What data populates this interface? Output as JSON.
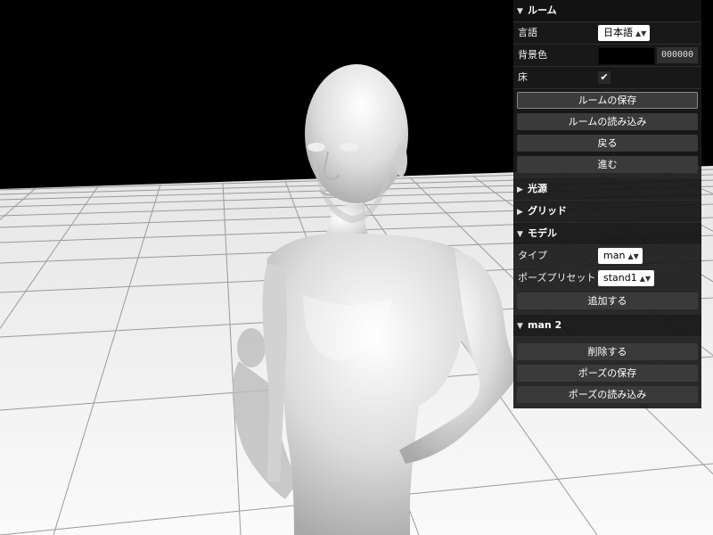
{
  "colors": {
    "sky": "#000000",
    "floor": "#f4f4f4",
    "grid": "#9a9a9a",
    "model": "#d8d8d8",
    "panel_bg": "#1a1a1a"
  },
  "room": {
    "title": "ルーム",
    "language_label": "言語",
    "language_value": "日本語",
    "bgcolor_label": "背景色",
    "bgcolor_hex": "000000",
    "floor_label": "床",
    "floor_checked": "✔",
    "save_label": "ルームの保存",
    "load_label": "ルームの読み込み",
    "undo_label": "戻る",
    "redo_label": "進む"
  },
  "light": {
    "title": "光源"
  },
  "grid": {
    "title": "グリッド"
  },
  "model": {
    "title": "モデル",
    "type_label": "タイプ",
    "type_value": "man",
    "pose_label": "ポーズプリセット",
    "pose_value": "stand1",
    "add_label": "追加する"
  },
  "man2": {
    "title": "man 2",
    "delete_label": "削除する",
    "save_pose_label": "ポーズの保存",
    "load_pose_label": "ポーズの読み込み"
  }
}
